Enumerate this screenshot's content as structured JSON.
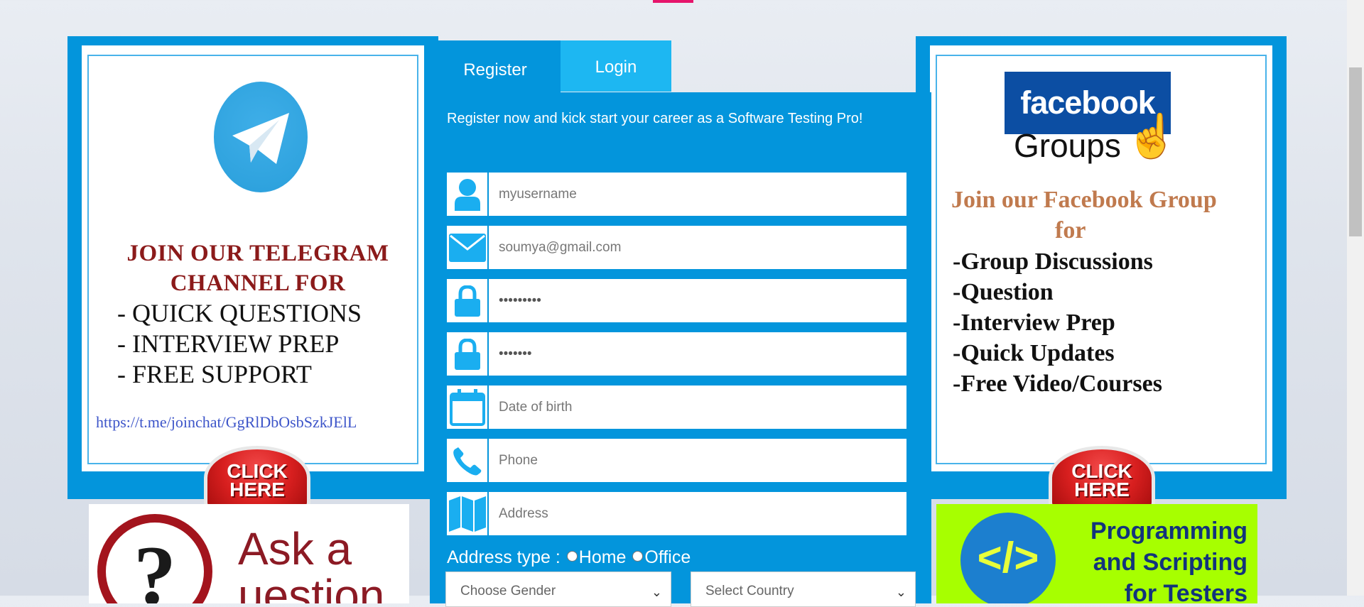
{
  "tabs": {
    "register": "Register",
    "login": "Login"
  },
  "intro": "Register now and kick start your career as a Software Testing Pro!",
  "fields": {
    "username": {
      "value": "",
      "placeholder": "myusername",
      "icon": "user-icon"
    },
    "email": {
      "value": "",
      "placeholder": "soumya@gmail.com",
      "icon": "envelope-icon"
    },
    "password": {
      "value": "passwords",
      "placeholder": "",
      "icon": "lock-icon"
    },
    "confirm_password": {
      "value": "abcdefg",
      "placeholder": "",
      "icon": "lock-icon"
    },
    "dob": {
      "value": "",
      "placeholder": "Date of birth",
      "icon": "calendar-icon"
    },
    "phone": {
      "value": "",
      "placeholder": "Phone",
      "icon": "phone-icon"
    },
    "address": {
      "value": "",
      "placeholder": "Address",
      "icon": "map-icon"
    }
  },
  "address_type": {
    "label": "Address type :",
    "home": "Home",
    "office": "Office"
  },
  "selects": {
    "gender": "Choose Gender",
    "country": "Select Country"
  },
  "telegram_ad": {
    "heading": "JOIN OUR TELEGRAM CHANNEL  FOR",
    "items": [
      "- QUICK QUESTIONS",
      "- INTERVIEW PREP",
      "- FREE SUPPORT"
    ],
    "link": "https://t.me/joinchat/GgRlDbOsbSzkJElL",
    "button_line1": "CLICK",
    "button_line2": "HERE"
  },
  "facebook_ad": {
    "logo": "facebook",
    "groups": "Groups",
    "heading": "Join our Facebook Group",
    "heading_for": "for",
    "items": [
      "-Group Discussions",
      "-Question",
      "-Interview Prep",
      "-Quick Updates",
      "-Free Video/Courses"
    ],
    "button_line1": "CLICK",
    "button_line2": "HERE"
  },
  "ask_ad": {
    "text_line1": "Ask a",
    "text_line2": "uestion"
  },
  "programming_ad": {
    "line1": "Programming",
    "line2": "and Scripting",
    "line3": "for Testers"
  },
  "colors": {
    "panel_blue": "#0395dc",
    "tab_login": "#1db7f2",
    "icon_blue": "#1aaef0",
    "accent_pink": "#e6156b"
  }
}
